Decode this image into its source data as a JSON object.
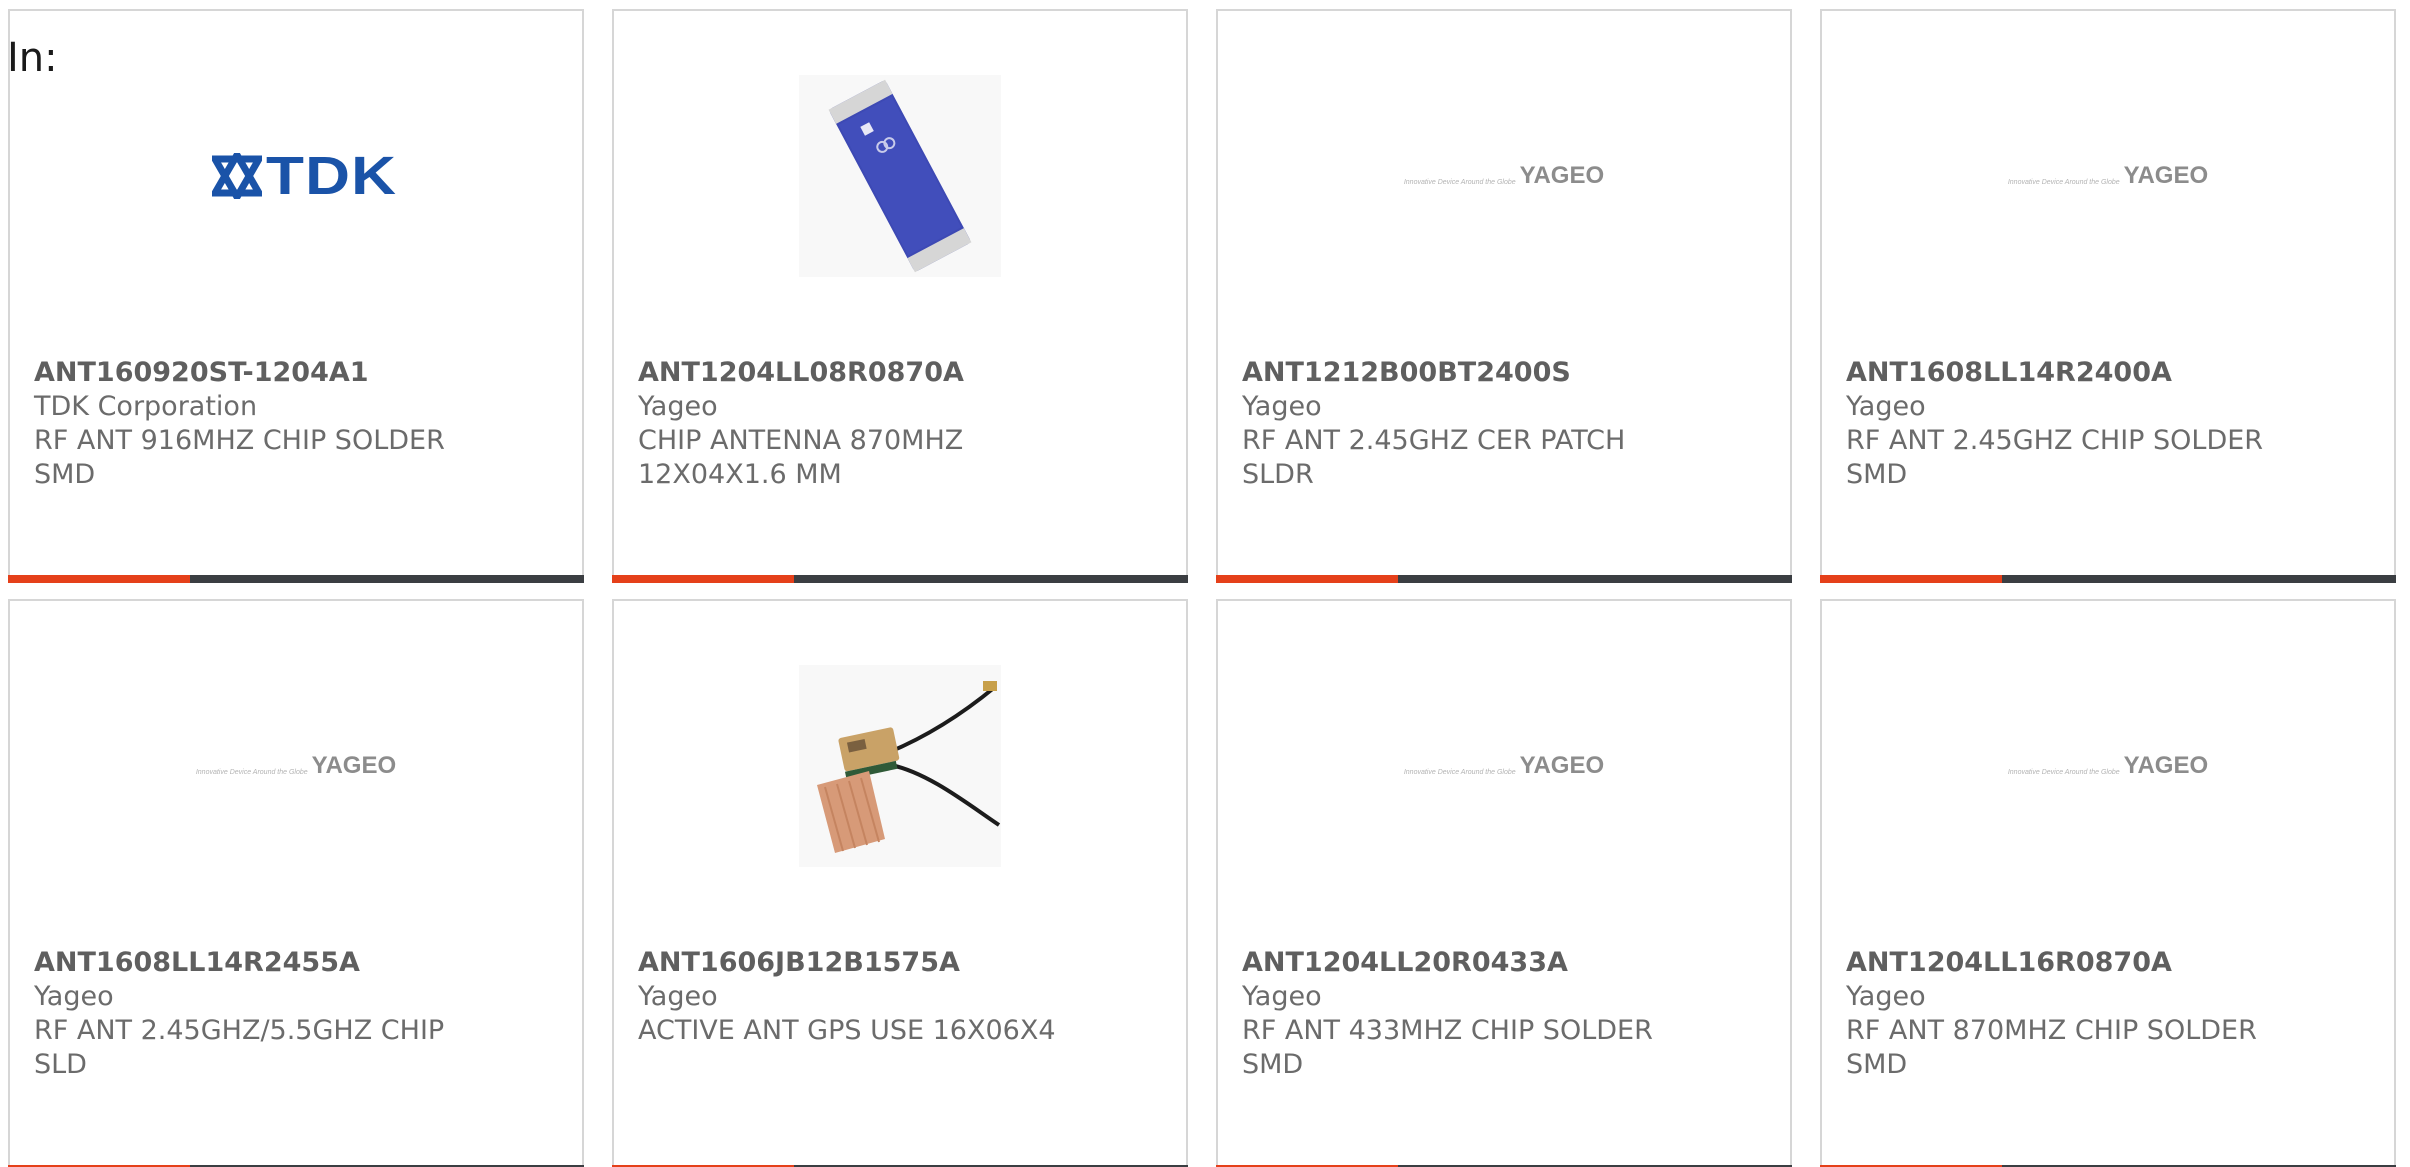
{
  "prefix_label": "In:",
  "colors": {
    "accent": "#e5401a",
    "bar": "#3b3e42",
    "tdk_blue": "#1a53a8",
    "chip_blue": "#3d49b4"
  },
  "cards": [
    {
      "logo": "tdk-logo",
      "logo_text": "TDK",
      "part_number": "ANT160920ST-1204A1",
      "manufacturer": "TDK Corporation",
      "description_line1": "RF ANT 916MHZ CHIP SOLDER",
      "description_line2": "SMD"
    },
    {
      "logo": "chip-antenna-photo",
      "part_number": "ANT1204LL08R0870A",
      "manufacturer": "Yageo",
      "description_line1": "CHIP ANTENNA 870MHZ",
      "description_line2": "12X04X1.6 MM"
    },
    {
      "logo": "yageo-logo",
      "logo_text": "YAGEO",
      "logo_tagline": "Innovative Device Around the Globe",
      "part_number": "ANT1212B00BT2400S",
      "manufacturer": "Yageo",
      "description_line1": "RF ANT 2.45GHZ CER PATCH",
      "description_line2": "SLDR"
    },
    {
      "logo": "yageo-logo",
      "logo_text": "YAGEO",
      "logo_tagline": "Innovative Device Around the Globe",
      "part_number": "ANT1608LL14R2400A",
      "manufacturer": "Yageo",
      "description_line1": "RF ANT 2.45GHZ CHIP SOLDER",
      "description_line2": "SMD"
    },
    {
      "logo": "yageo-logo",
      "logo_text": "YAGEO",
      "logo_tagline": "Innovative Device Around the Globe",
      "part_number": "ANT1608LL14R2455A",
      "manufacturer": "Yageo",
      "description_line1": "RF ANT 2.45GHZ/5.5GHZ CHIP",
      "description_line2": "SLD"
    },
    {
      "logo": "gps-antenna-photo",
      "part_number": "ANT1606JB12B1575A",
      "manufacturer": "Yageo",
      "description_line1": "ACTIVE ANT GPS USE 16X06X4",
      "description_line2": ""
    },
    {
      "logo": "yageo-logo",
      "logo_text": "YAGEO",
      "logo_tagline": "Innovative Device Around the Globe",
      "part_number": "ANT1204LL20R0433A",
      "manufacturer": "Yageo",
      "description_line1": "RF ANT 433MHZ CHIP SOLDER",
      "description_line2": "SMD"
    },
    {
      "logo": "yageo-logo",
      "logo_text": "YAGEO",
      "logo_tagline": "Innovative Device Around the Globe",
      "part_number": "ANT1204LL16R0870A",
      "manufacturer": "Yageo",
      "description_line1": "RF ANT 870MHZ CHIP SOLDER",
      "description_line2": "SMD"
    }
  ]
}
